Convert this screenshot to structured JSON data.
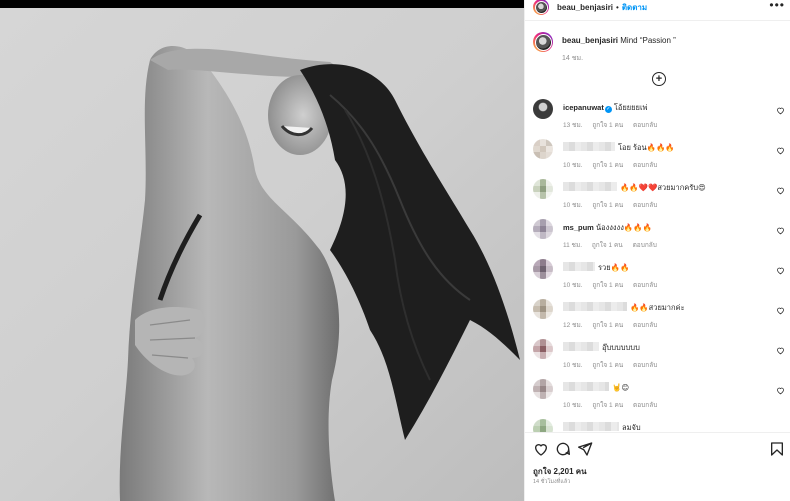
{
  "post": {
    "username": "beau_benjasiri",
    "separator": "•",
    "follow_label": "ติดตาม",
    "more_label": "•••"
  },
  "caption": {
    "username": "beau_benjasiri",
    "text": "Mind “Passion ”",
    "time": "14 ชม."
  },
  "load_more_label": "+",
  "comments": [
    {
      "username": "icepanuwat",
      "verified": true,
      "text": "โอ้ยยยยเพ่",
      "time": "13 ชม.",
      "likes": "ถูกใจ 1 คน",
      "reply": "ตอบกลับ"
    },
    {
      "username": "",
      "verified": false,
      "text": "โอย ร้อน🔥🔥🔥",
      "time": "10 ชม.",
      "likes": "ถูกใจ 1 คน",
      "reply": "ตอบกลับ"
    },
    {
      "username": "",
      "verified": false,
      "text": "🔥🔥❤️❤️สวยมากครับ😍",
      "time": "10 ชม.",
      "likes": "ถูกใจ 1 คน",
      "reply": "ตอบกลับ"
    },
    {
      "username": "ms_pum",
      "verified": false,
      "text": "น้องงงงง🔥🔥🔥",
      "time": "11 ชม.",
      "likes": "ถูกใจ 1 คน",
      "reply": "ตอบกลับ"
    },
    {
      "username": "",
      "verified": false,
      "text": "รวย🔥🔥",
      "time": "10 ชม.",
      "likes": "ถูกใจ 1 คน",
      "reply": "ตอบกลับ"
    },
    {
      "username": "",
      "verified": false,
      "text": "🔥🔥สวยมากค่ะ",
      "time": "12 ชม.",
      "likes": "ถูกใจ 1 คน",
      "reply": "ตอบกลับ"
    },
    {
      "username": "",
      "verified": false,
      "text": "อุ๊บบบบบบบ",
      "time": "10 ชม.",
      "likes": "ถูกใจ 1 คน",
      "reply": "ตอบกลับ"
    },
    {
      "username": "",
      "verified": false,
      "text": "🤘😊",
      "time": "10 ชม.",
      "likes": "ถูกใจ 1 คน",
      "reply": "ตอบกลับ"
    },
    {
      "username": "",
      "verified": false,
      "text": "ลมจับ",
      "time": "",
      "likes": "",
      "reply": ""
    }
  ],
  "footer": {
    "likes_label": "ถูกใจ 2,201 คน",
    "date": "14 ชั่วโมงที่แล้ว"
  },
  "icons": [
    "more-icon",
    "add-comment-icon",
    "heart-icon",
    "comment-icon",
    "share-icon",
    "bookmark-icon",
    "verified-icon"
  ],
  "colors": {
    "accent": "#0095f6",
    "text": "#262626",
    "muted": "#8e8e8e",
    "border": "#efefef"
  }
}
